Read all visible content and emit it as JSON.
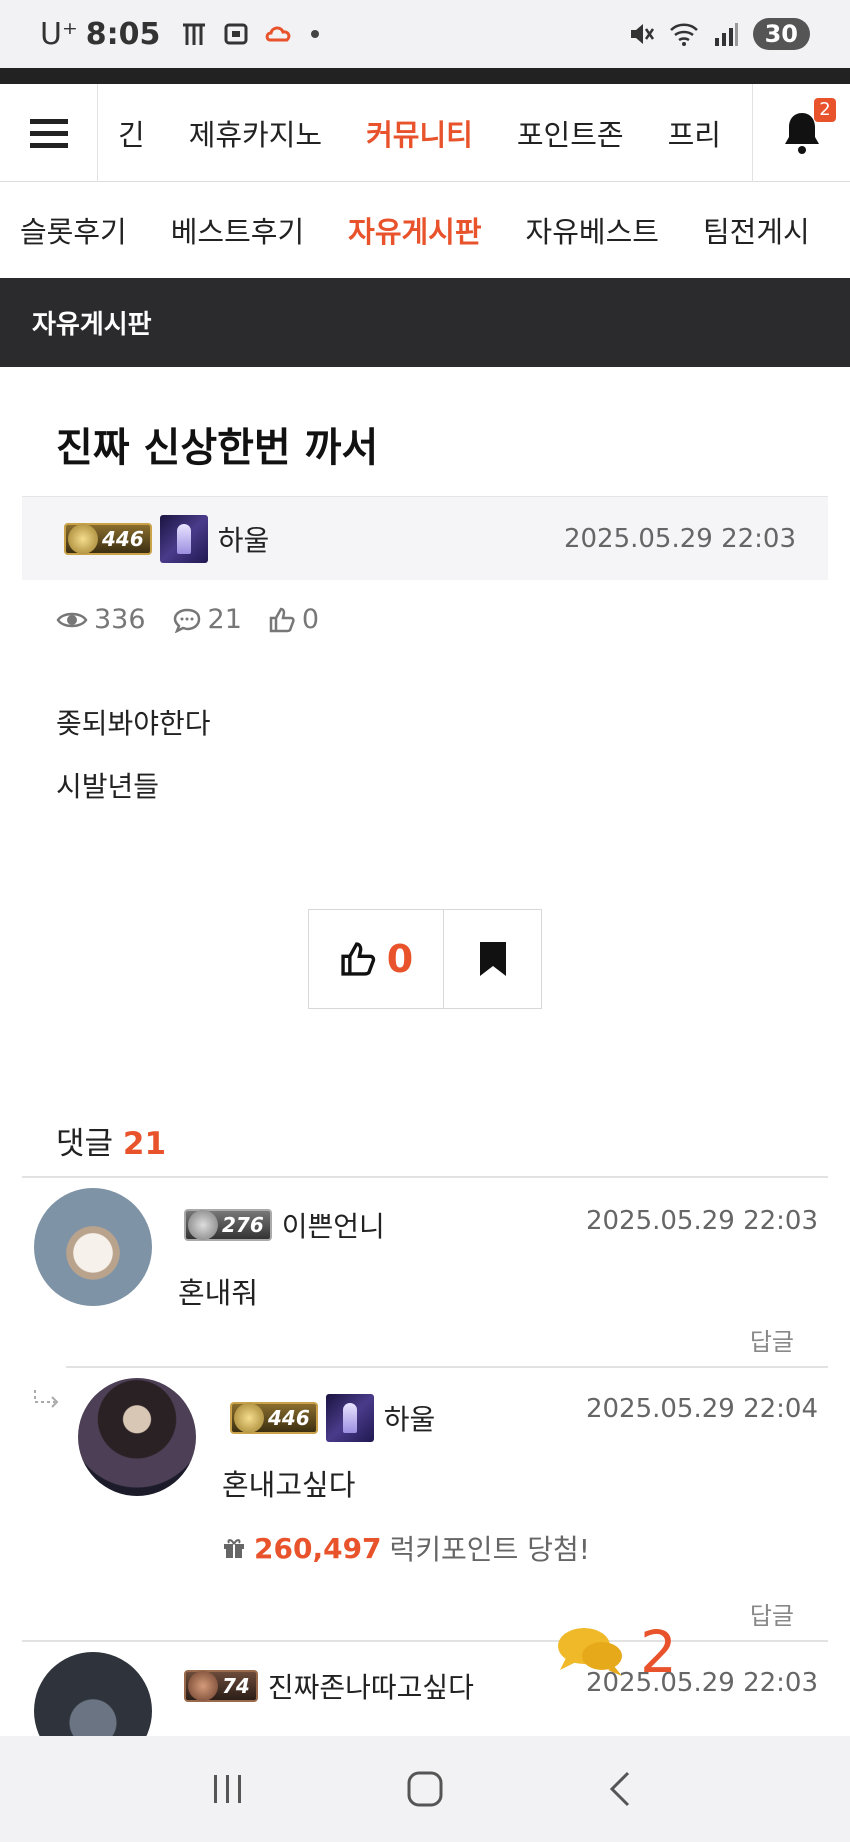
{
  "status_bar": {
    "carrier": "U⁺",
    "time": "8:05",
    "battery": "30"
  },
  "main_nav": {
    "items": [
      {
        "label": "긴",
        "active": false
      },
      {
        "label": "제휴카지노",
        "active": false
      },
      {
        "label": "커뮤니티",
        "active": true
      },
      {
        "label": "포인트존",
        "active": false
      },
      {
        "label": "프리",
        "active": false
      }
    ],
    "notification_count": "2"
  },
  "sub_nav": {
    "items": [
      {
        "label": "슬롯후기",
        "active": false
      },
      {
        "label": "베스트후기",
        "active": false
      },
      {
        "label": "자유게시판",
        "active": true
      },
      {
        "label": "자유베스트",
        "active": false
      },
      {
        "label": "팀전게시",
        "active": false
      }
    ]
  },
  "board": {
    "title": "자유게시판"
  },
  "post": {
    "title": "진짜 신상한번 까서",
    "author": {
      "level": "446",
      "name": "하울"
    },
    "date": "2025.05.29 22:03",
    "views": "336",
    "comments": "21",
    "likes": "0",
    "content": [
      "좆되봐야한다",
      "시발년들"
    ],
    "like_count": "0"
  },
  "comments_section": {
    "label": "댓글",
    "count": "21",
    "items": [
      {
        "level": "276",
        "name": "이쁜언니",
        "date": "2025.05.29 22:03",
        "text": "혼내줘",
        "reply_label": "답글"
      },
      {
        "level": "446",
        "name": "하울",
        "date": "2025.05.29 22:04",
        "text": "혼내고싶다",
        "lucky_points": "260,497",
        "lucky_text": "럭키포인트 당첨!",
        "reply_label": "답글"
      },
      {
        "level": "74",
        "name": "진짜존나따고싶다",
        "date": "2025.05.29 22:03"
      }
    ]
  },
  "floating_chat": {
    "count": "2"
  },
  "colors": {
    "accent": "#e8532c",
    "header_dark": "#2b2b2d",
    "chat_icon": "#f0b92a"
  }
}
